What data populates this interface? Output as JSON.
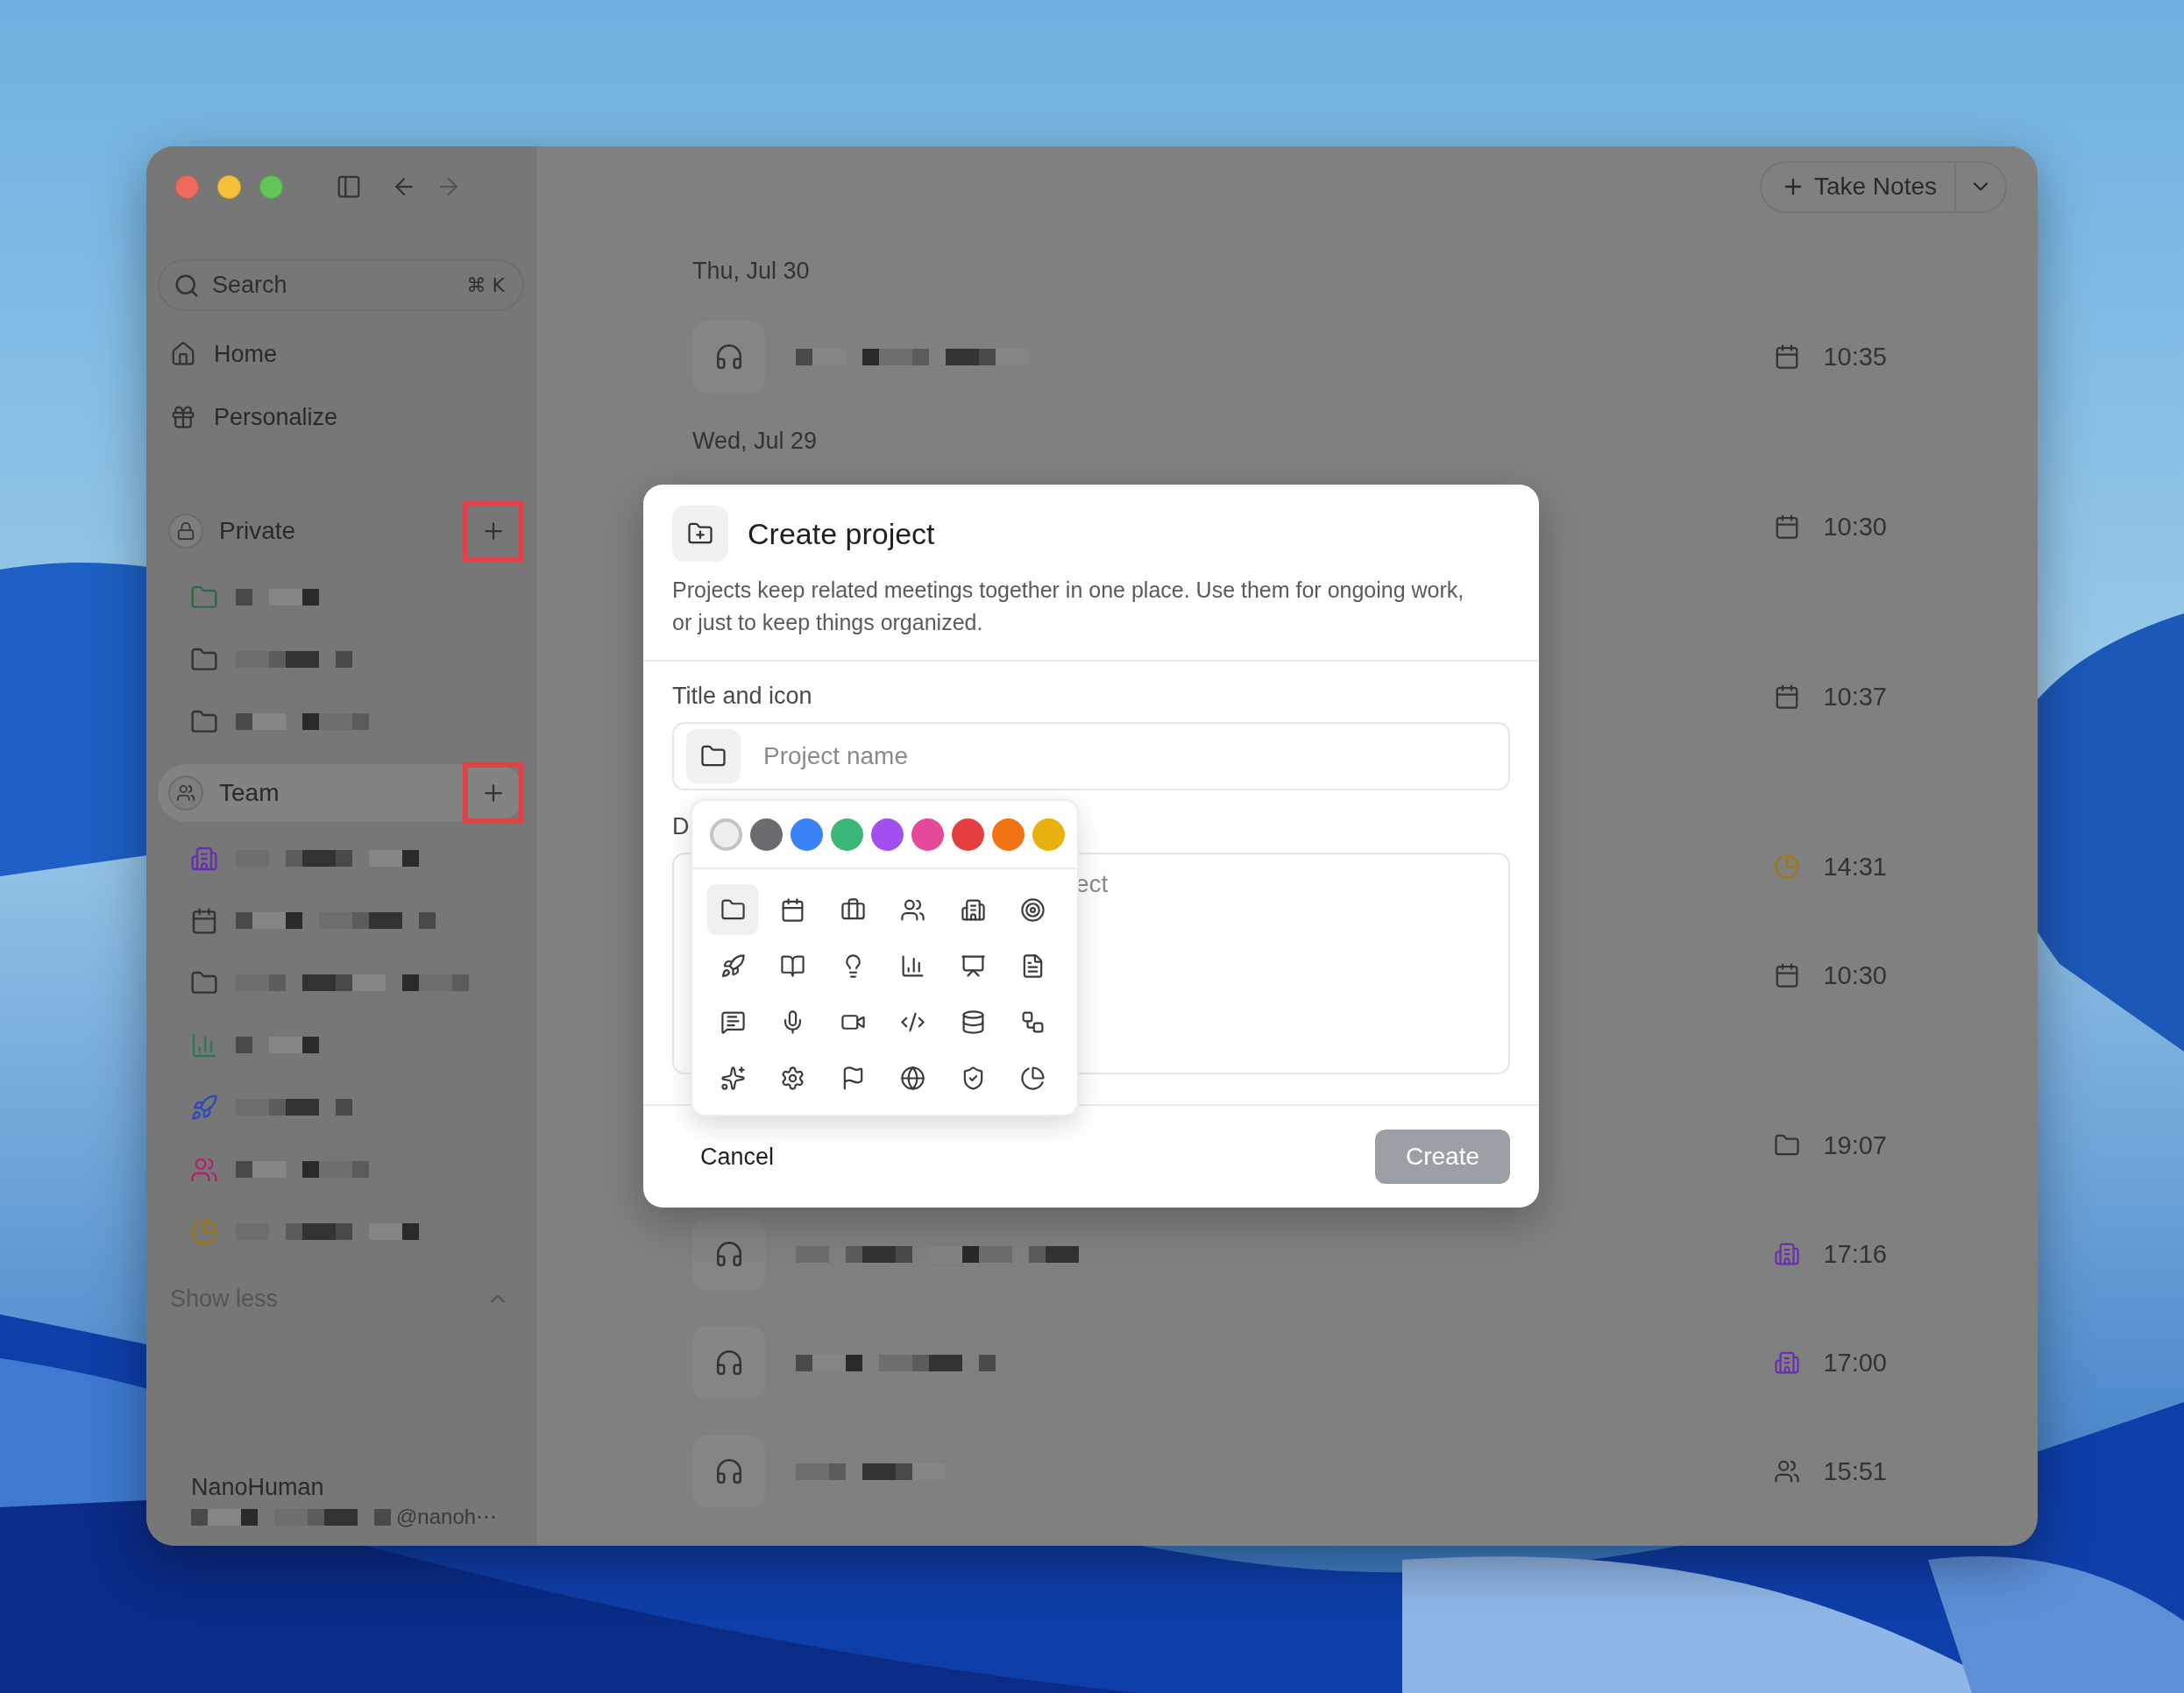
{
  "window": {
    "nav": [
      {
        "kind": "back",
        "disabled": false
      },
      {
        "kind": "forward",
        "disabled": true
      }
    ]
  },
  "sidebar": {
    "search": {
      "placeholder": "Search",
      "shortcut": "⌘ K"
    },
    "nav_items": [
      {
        "kind": "home",
        "label": "Home"
      },
      {
        "kind": "gift",
        "label": "Personalize"
      }
    ],
    "sections": [
      {
        "kind": "lock",
        "label": "Private",
        "selected": false,
        "add_highlighted": true,
        "items": [
          {
            "kind": "folder",
            "color": "#2f6b45"
          },
          {
            "kind": "folder",
            "color": "#333333"
          },
          {
            "kind": "folder",
            "color": "#333333"
          }
        ]
      },
      {
        "kind": "users",
        "label": "Team",
        "selected": true,
        "add_highlighted": true,
        "items": [
          {
            "kind": "building",
            "color": "#6a2fb0"
          },
          {
            "kind": "calendar",
            "color": "#333333"
          },
          {
            "kind": "folder",
            "color": "#333333"
          },
          {
            "kind": "chart",
            "color": "#2a7a52"
          },
          {
            "kind": "rocket",
            "color": "#2a4bb8"
          },
          {
            "kind": "users",
            "color": "#b0246a"
          },
          {
            "kind": "pie",
            "color": "#a07a10"
          }
        ]
      }
    ],
    "toggle": {
      "label": "Show less",
      "expanded": true
    },
    "account": {
      "name": "NanoHuman",
      "email": "@nanoh⋯"
    }
  },
  "main": {
    "take_notes": {
      "label": "Take Notes"
    },
    "groups": [
      {
        "date": "Thu, Jul 30",
        "rows": [
          {
            "kind": "calendar",
            "color": "#333333",
            "time": "10:35"
          }
        ]
      },
      {
        "date": "Wed, Jul 29",
        "rows": [
          {
            "kind": "calendar",
            "color": "#333333",
            "time": "10:30"
          }
        ]
      },
      {
        "rows": [
          {
            "kind": "calendar",
            "color": "#333333",
            "time": "10:37"
          }
        ]
      },
      {
        "rows": [
          {
            "kind": "pie",
            "color": "#a07a10",
            "time": "14:31"
          },
          {
            "kind": "calendar",
            "color": "#333333",
            "time": "10:30"
          }
        ]
      },
      {
        "rows": [
          {
            "kind": "folder",
            "color": "#333333",
            "time": "19:07"
          },
          {
            "kind": "building",
            "color": "#6a2fb0",
            "time": "17:16"
          },
          {
            "kind": "building",
            "color": "#6a2fb0",
            "time": "17:00"
          },
          {
            "kind": "users",
            "color": "#333333",
            "time": "15:51"
          }
        ]
      }
    ]
  },
  "dialog": {
    "title": "Create project",
    "description": "Projects keep related meetings together in one place. Use them for ongoing work, or just to keep things organized.",
    "title_label": "Title and icon",
    "name_placeholder": "Project name",
    "description_label": "D",
    "description_placeholder": "ect",
    "colors": [
      {
        "color": "#eeeeee",
        "selected": true
      },
      {
        "color": "#6b6b70",
        "selected": false
      },
      {
        "color": "#3b82f6",
        "selected": false
      },
      {
        "color": "#3cb77a",
        "selected": false
      },
      {
        "color": "#a24ff0",
        "selected": false
      },
      {
        "color": "#e6489a",
        "selected": false
      },
      {
        "color": "#e53e3e",
        "selected": false
      },
      {
        "color": "#f07316",
        "selected": false
      },
      {
        "color": "#e8b10e",
        "selected": false
      }
    ],
    "icons": [
      {
        "kind": "folder",
        "selected": true
      },
      {
        "kind": "calendar",
        "selected": false
      },
      {
        "kind": "briefcase",
        "selected": false
      },
      {
        "kind": "users",
        "selected": false
      },
      {
        "kind": "building",
        "selected": false
      },
      {
        "kind": "target",
        "selected": false
      },
      {
        "kind": "rocket",
        "selected": false
      },
      {
        "kind": "book",
        "selected": false
      },
      {
        "kind": "bulb",
        "selected": false
      },
      {
        "kind": "chart",
        "selected": false
      },
      {
        "kind": "presentation",
        "selected": false
      },
      {
        "kind": "file",
        "selected": false
      },
      {
        "kind": "message",
        "selected": false
      },
      {
        "kind": "mic",
        "selected": false
      },
      {
        "kind": "video",
        "selected": false
      },
      {
        "kind": "code",
        "selected": false
      },
      {
        "kind": "database",
        "selected": false
      },
      {
        "kind": "workflow",
        "selected": false
      },
      {
        "kind": "sparkles",
        "selected": false
      },
      {
        "kind": "settings",
        "selected": false
      },
      {
        "kind": "flag",
        "selected": false
      },
      {
        "kind": "globe",
        "selected": false
      },
      {
        "kind": "shield",
        "selected": false
      },
      {
        "kind": "pie",
        "selected": false
      }
    ],
    "cancel": "Cancel",
    "create": {
      "label": "Create",
      "disabled": true
    }
  }
}
